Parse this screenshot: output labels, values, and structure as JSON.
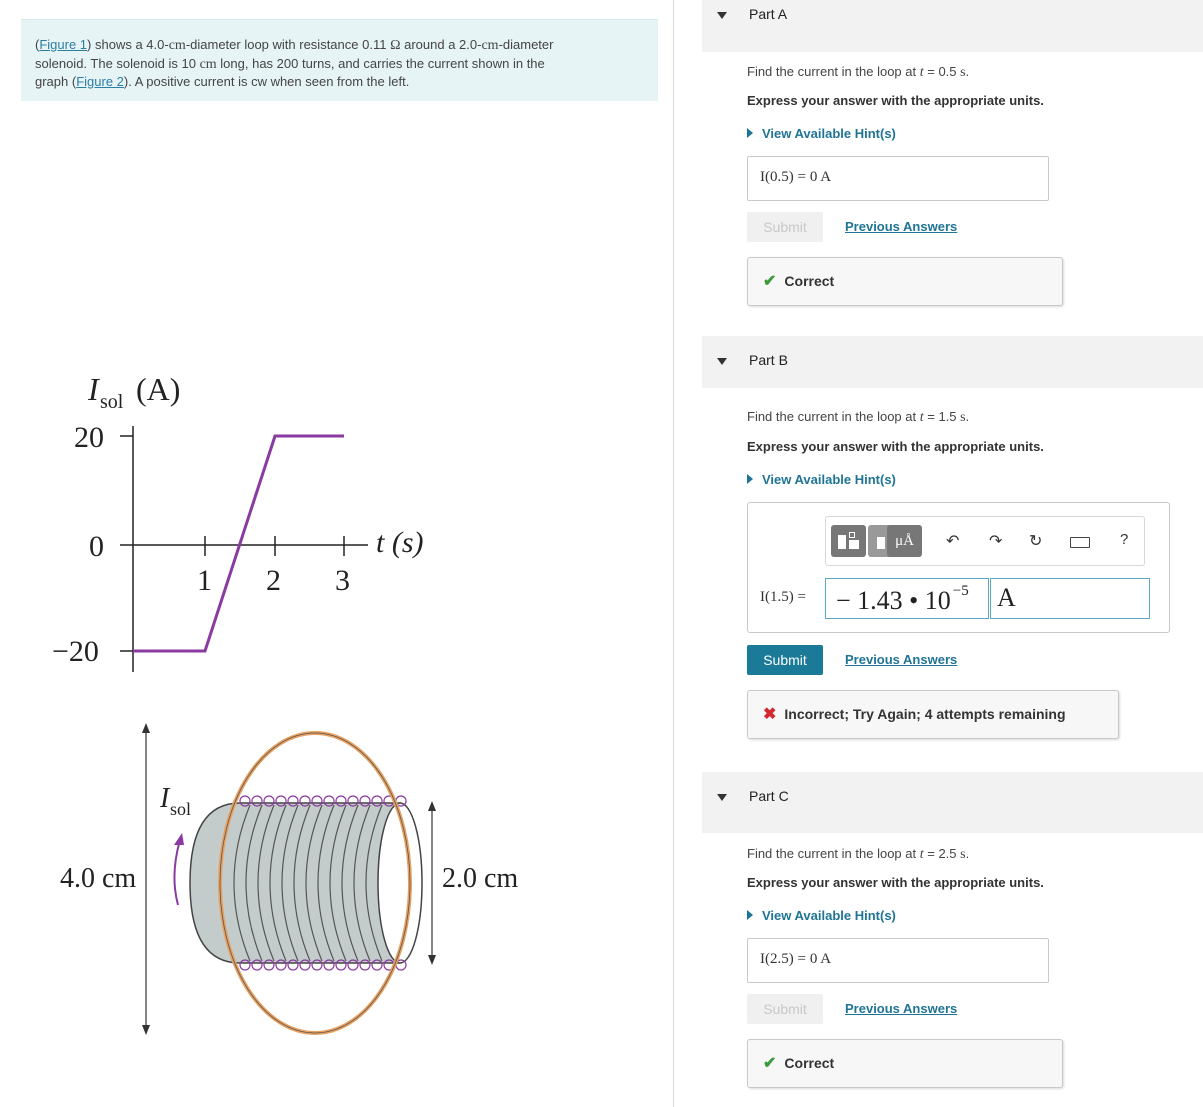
{
  "problem": {
    "fig1_link": "Figure 1",
    "t1": "shows a 4.0-",
    "u_cm1": "cm",
    "t2": "-diameter loop with resistance 0.11",
    "u_ohm": "Ω",
    "t3": "around a 2.0-",
    "u_cm2": "cm",
    "t4": "-diameter",
    "t5": "solenoid.  The solenoid is 10",
    "u_cm3": "cm",
    "t6": "long, has 200 turns, and carries the current shown in the",
    "t7": "graph (",
    "fig2_link": "Figure 2",
    "t8": "). A positive current is cw when seen from the left."
  },
  "graph": {
    "ylabel_I": "I",
    "ylabel_sub": "sol",
    "ylabel_unit": "(A)",
    "xlabel": "t (s)",
    "yticks": [
      "20",
      "0",
      "−20"
    ],
    "xticks": [
      "1",
      "2",
      "3"
    ],
    "line_color": "#8a3aa0"
  },
  "figure2": {
    "label_left": "4.0 cm",
    "label_right": "2.0 cm",
    "isol_I": "I",
    "isol_sub": "sol",
    "loop_color": "#e8a060",
    "coil_color": "#c3cccb",
    "winding_color": "#8a3aa0"
  },
  "parts": {
    "a": {
      "title": "Part A",
      "q_prefix": "Find the current in the loop at",
      "q_var": "t",
      "q_eq": "= 0.5",
      "q_unit": "s",
      "express": "Express your answer with the appropriate units.",
      "hint": "View Available Hint(s)",
      "ans_label": "I(0.5) =",
      "ans_value": "0 A",
      "submit": "Submit",
      "prev": "Previous Answers",
      "feedback": "Correct"
    },
    "b": {
      "title": "Part B",
      "q_prefix": "Find the current in the loop at",
      "q_var": "t",
      "q_eq": "= 1.5",
      "q_unit": "s",
      "express": "Express your answer with the appropriate units.",
      "hint": "View Available Hint(s)",
      "ans_label": "I(1.5) =",
      "ans_mantissa": "− 1.43 • 10",
      "ans_exp": "−5",
      "ans_unit": "A",
      "submit": "Submit",
      "prev": "Previous Answers",
      "feedback": "Incorrect; Try Again; 4 attempts remaining",
      "toolbar": {
        "units_label": "μÅ",
        "help": "?",
        "undo": "undo-icon",
        "redo": "redo-icon",
        "reset": "reset-icon",
        "keyboard": "keyboard-icon"
      }
    },
    "c": {
      "title": "Part C",
      "q_prefix": "Find the current in the loop at",
      "q_var": "t",
      "q_eq": "= 2.5",
      "q_unit": "s",
      "express": "Express your answer with the appropriate units.",
      "hint": "View Available Hint(s)",
      "ans_label": "I(2.5) =",
      "ans_value": "0 A",
      "submit": "Submit",
      "prev": "Previous Answers",
      "feedback": "Correct"
    }
  },
  "colors": {
    "accent": "#1a7a97",
    "link": "#1f7496",
    "correct": "#3c9a3c",
    "incorrect": "#d3262d"
  }
}
